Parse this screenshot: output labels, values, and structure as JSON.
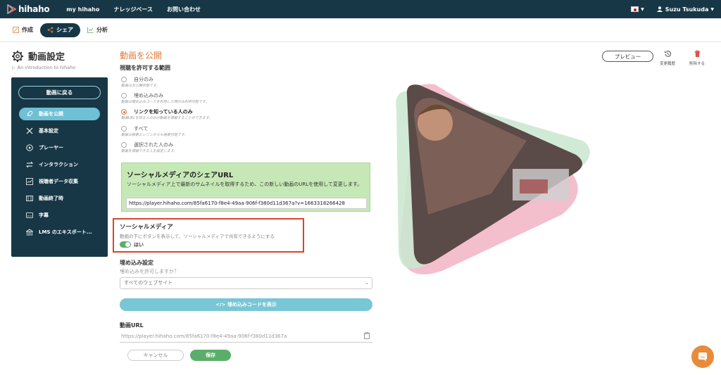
{
  "topnav": {
    "logo": "hihaho",
    "links": [
      "my hihaho",
      "ナレッジベース",
      "お問い合わせ"
    ],
    "user": "Suzu Tsukuda"
  },
  "subtabs": [
    {
      "label": "作成",
      "active": false
    },
    {
      "label": "シェア",
      "active": true
    },
    {
      "label": "分析",
      "active": false
    }
  ],
  "page": {
    "title": "動画設定",
    "breadcrumb": "An introduction to hihaho"
  },
  "sidebar": {
    "back_label": "動画に戻る",
    "items": [
      {
        "label": "動画を公開",
        "icon": "rocket-icon",
        "active": true
      },
      {
        "label": "基本設定",
        "icon": "tools-icon",
        "active": false
      },
      {
        "label": "プレーヤー",
        "icon": "play-circle-icon",
        "active": false
      },
      {
        "label": "インタラクション",
        "icon": "swap-arrows-icon",
        "active": false
      },
      {
        "label": "視聴者データ収集",
        "icon": "chart-icon",
        "active": false
      },
      {
        "label": "動画終了時",
        "icon": "film-icon",
        "active": false
      },
      {
        "label": "字幕",
        "icon": "caption-icon",
        "active": false
      },
      {
        "label": "LMS のエキスポート...",
        "icon": "building-icon",
        "active": false
      }
    ]
  },
  "main": {
    "title": "動画を公開",
    "access_label": "視聴を許可する範囲",
    "options": [
      {
        "label": "自分のみ",
        "desc": "動画は非公開状態です。",
        "checked": false
      },
      {
        "label": "埋め込みのみ",
        "desc": "動画は埋め込みコードを利用した時のみ利用可能です。",
        "checked": false
      },
      {
        "label": "リンクを知っている人のみ",
        "desc": "動画URLを知る人のみが動画を視聴することができます。",
        "checked": true
      },
      {
        "label": "すべて",
        "desc": "動画は検索エンジンからも検索可能です。",
        "checked": false
      },
      {
        "label": "選択された人のみ",
        "desc": "動画を視聴できる人を設定します。",
        "checked": false
      }
    ],
    "share_box": {
      "title": "ソーシャルメディアのシェアURL",
      "desc": "ソーシャルメディア上で最新のサムネイルを取得するため、この新しい動画のURLを使用して変更します。",
      "url": "https://player.hihaho.com/85fa6170-f8e4-49aa-906f-f380d11d367a?v=1663318266428"
    },
    "social": {
      "title": "ソーシャルメディア",
      "desc": "動画の下にボタンを表示して、ソーシャルメディアで共有できるようにする",
      "toggle_label": "はい"
    },
    "embed": {
      "title": "埋め込み設定",
      "question": "埋め込みを許可しますか？",
      "select_value": "すべてのウェブサイト",
      "button": "</> 埋め込みコードを表示"
    },
    "video_url": {
      "title": "動画URL",
      "value": "https://player.hihaho.com/85fa6170-f8e4-49aa-906f-f380d11d367a"
    },
    "cancel": "キャンセル",
    "save": "保存"
  },
  "actions": {
    "preview": "プレビュー",
    "history": "変更履歴",
    "delete": "削除する"
  },
  "colors": {
    "nav": "#173746",
    "accent": "#e07a3a",
    "active_tab": "#6fc0d4",
    "green": "#5cad6b",
    "highlight": "#d9452c"
  }
}
